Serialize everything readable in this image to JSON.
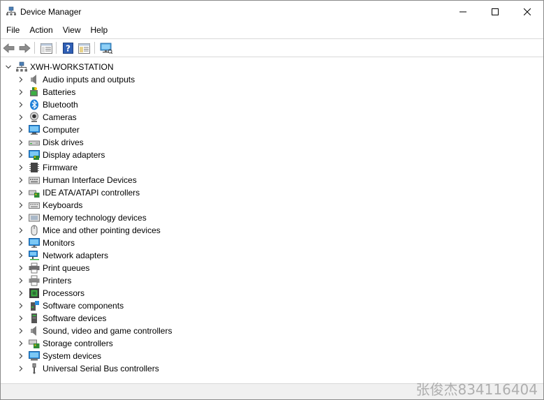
{
  "window": {
    "title": "Device Manager",
    "minimize_icon": "minimize-icon",
    "maximize_icon": "maximize-icon",
    "close_icon": "close-icon"
  },
  "menu": [
    {
      "label": "File"
    },
    {
      "label": "Action"
    },
    {
      "label": "View"
    },
    {
      "label": "Help"
    }
  ],
  "toolbar": {
    "buttons": [
      "back-arrow-icon",
      "forward-arrow-icon",
      "properties-list-icon",
      "help-icon",
      "console-tree-icon",
      "monitor-icon"
    ]
  },
  "tree": {
    "root": {
      "label": "XWH-WORKSTATION",
      "icon": "computer-tree-icon",
      "expanded": true
    },
    "categories": [
      {
        "label": "Audio inputs and outputs",
        "icon": "speaker-icon"
      },
      {
        "label": "Batteries",
        "icon": "battery-icon"
      },
      {
        "label": "Bluetooth",
        "icon": "bluetooth-icon"
      },
      {
        "label": "Cameras",
        "icon": "camera-icon"
      },
      {
        "label": "Computer",
        "icon": "computer-icon"
      },
      {
        "label": "Disk drives",
        "icon": "disk-drive-icon"
      },
      {
        "label": "Display adapters",
        "icon": "display-adapter-icon"
      },
      {
        "label": "Firmware",
        "icon": "firmware-icon"
      },
      {
        "label": "Human Interface Devices",
        "icon": "hid-icon"
      },
      {
        "label": "IDE ATA/ATAPI controllers",
        "icon": "ide-controller-icon"
      },
      {
        "label": "Keyboards",
        "icon": "keyboard-icon"
      },
      {
        "label": "Memory technology devices",
        "icon": "memory-icon"
      },
      {
        "label": "Mice and other pointing devices",
        "icon": "mouse-icon"
      },
      {
        "label": "Monitors",
        "icon": "monitor-icon"
      },
      {
        "label": "Network adapters",
        "icon": "network-adapter-icon"
      },
      {
        "label": "Print queues",
        "icon": "print-queue-icon"
      },
      {
        "label": "Printers",
        "icon": "printer-icon"
      },
      {
        "label": "Processors",
        "icon": "processor-icon"
      },
      {
        "label": "Software components",
        "icon": "software-component-icon"
      },
      {
        "label": "Software devices",
        "icon": "software-device-icon"
      },
      {
        "label": "Sound, video and game controllers",
        "icon": "sound-controller-icon"
      },
      {
        "label": "Storage controllers",
        "icon": "storage-controller-icon"
      },
      {
        "label": "System devices",
        "icon": "system-device-icon"
      },
      {
        "label": "Universal Serial Bus controllers",
        "icon": "usb-icon"
      }
    ]
  },
  "watermark": "张俊杰834116404",
  "colors": {
    "accent_blue": "#1e90e0",
    "icon_gray": "#6d6d6d"
  }
}
